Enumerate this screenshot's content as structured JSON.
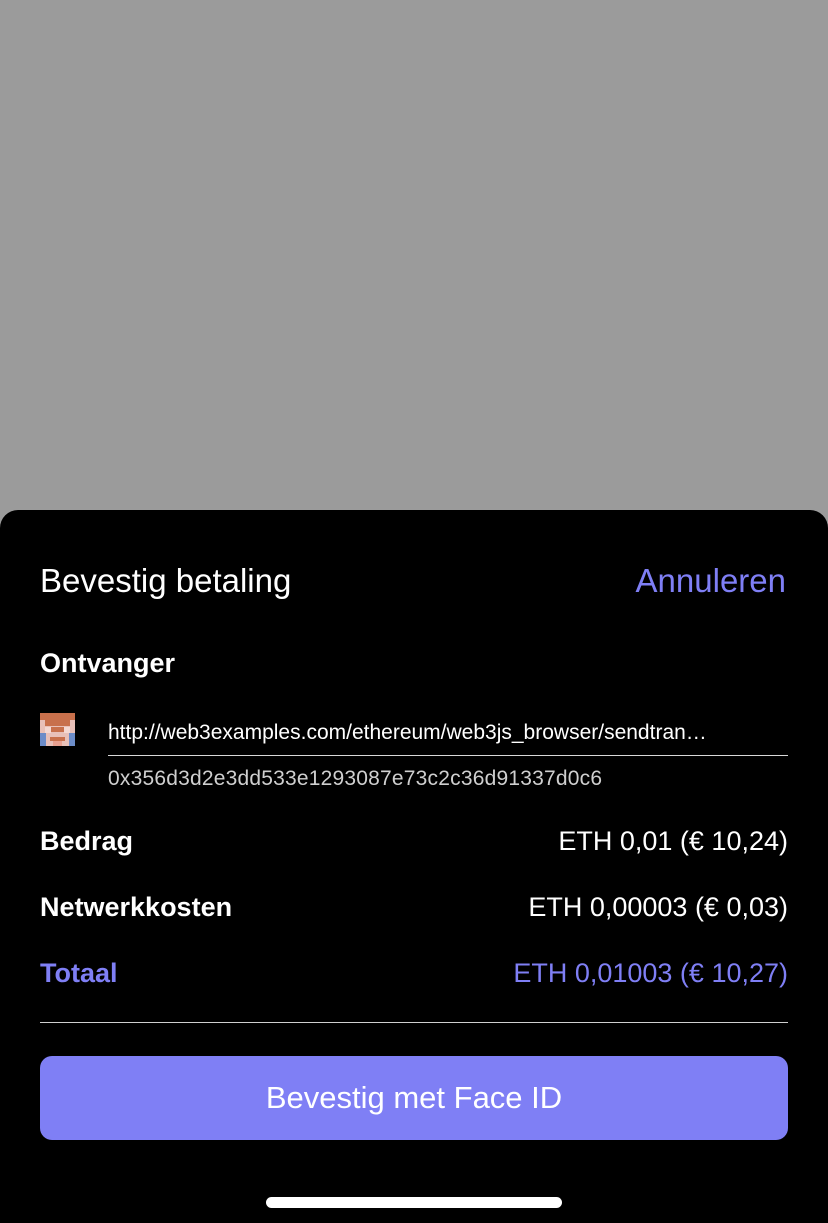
{
  "sheet": {
    "title": "Bevestig betaling",
    "cancel_label": "Annuleren"
  },
  "recipient": {
    "section_label": "Ontvanger",
    "url": "http://web3examples.com/ethereum/web3js_browser/sendtran…",
    "address": "0x356d3d2e3dd533e1293087e73c2c36d91337d0c6",
    "avatar_icon": "pixel-avatar-icon"
  },
  "summary": {
    "amount_label": "Bedrag",
    "amount_value": "ETH 0,01 (€ 10,24)",
    "fee_label": "Netwerkkosten",
    "fee_value": "ETH 0,00003 (€ 0,03)",
    "total_label": "Totaal",
    "total_value": "ETH 0,01003 (€ 10,27)"
  },
  "actions": {
    "confirm_label": "Bevestig met Face ID"
  },
  "colors": {
    "accent": "#7f7ff5",
    "sheet_background": "#000000",
    "backdrop": "#9b9b9b"
  }
}
